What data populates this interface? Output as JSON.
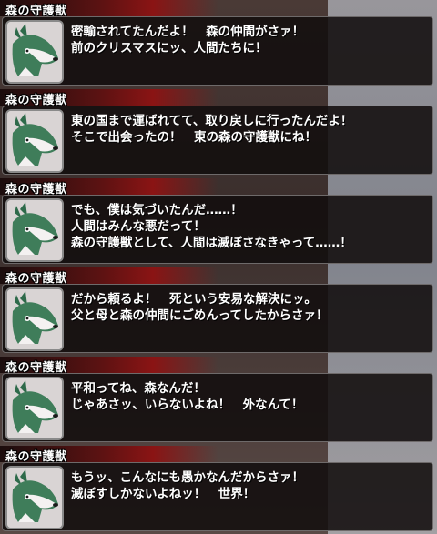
{
  "speaker": "森の守護獣",
  "panels": [
    {
      "lines": [
        "密輸されてたんだよ！　森の仲間がさァ！",
        "前のクリスマスにッ、人間たちに！"
      ]
    },
    {
      "lines": [
        "東の国まで運ばれてて、取り戻しに行ったんだよ！",
        "そこで出会ったの！　東の森の守護獣にね！"
      ]
    },
    {
      "lines": [
        "でも、僕は気づいたんだ……！",
        "人間はみんな悪だって！",
        "森の守護獣として、人間は滅ぼさなきゃって……！"
      ]
    },
    {
      "lines": [
        "だから頼るよ！　死という安易な解決にッ。",
        "父と母と森の仲間にごめんってしたからさァ！"
      ]
    },
    {
      "lines": [
        "平和ってね、森なんだ！",
        "じゃあさッ、いらないよね！　外なんて！"
      ]
    },
    {
      "lines": [
        "もうッ、こんなにも愚かなんだからさァ！",
        "滅ぼすしかないよねッ！　世界！"
      ]
    }
  ]
}
